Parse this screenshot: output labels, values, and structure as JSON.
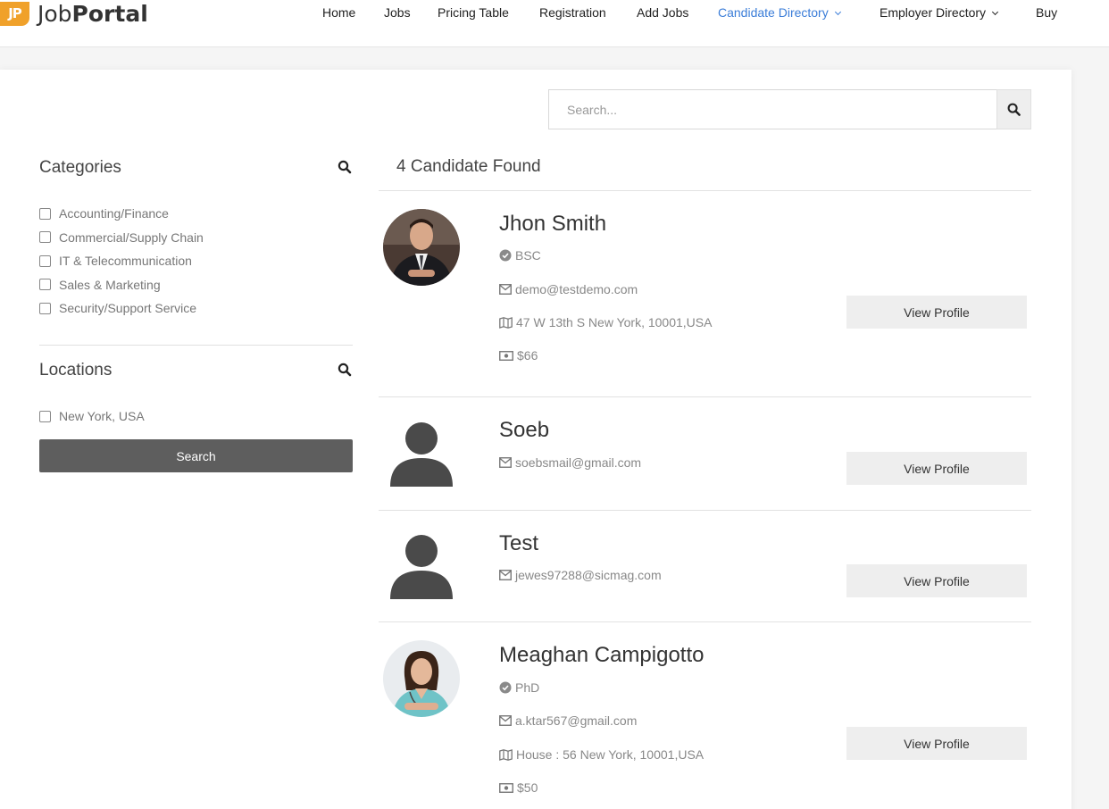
{
  "brand": {
    "logo_mark": "JP",
    "name_part1": "Job",
    "name_part2": "Portal"
  },
  "nav": [
    {
      "label": "Home"
    },
    {
      "label": "Jobs"
    },
    {
      "label": "Pricing Table"
    },
    {
      "label": "Registration"
    },
    {
      "label": "Add Jobs"
    },
    {
      "label": "Candidate Directory",
      "active": true,
      "dropdown": true
    },
    {
      "label": "Employer Directory",
      "dropdown": true
    },
    {
      "label": "Buy"
    }
  ],
  "search": {
    "placeholder": "Search...",
    "icon": "search-icon"
  },
  "sidebar": {
    "categories_title": "Categories",
    "categories": [
      "Accounting/Finance",
      "Commercial/Supply Chain",
      "IT & Telecommunication",
      "Sales & Marketing",
      "Security/Support Service"
    ],
    "locations_title": "Locations",
    "locations": [
      "New York, USA"
    ],
    "search_button": "Search"
  },
  "results": {
    "count_label": "4 Candidate Found",
    "view_profile_label": "View Profile",
    "candidates": [
      {
        "name": "Jhon Smith",
        "degree": "BSC",
        "email": "demo@testdemo.com",
        "address": "47 W 13th S New York, 10001,USA",
        "rate": "$66",
        "avatar": "photo-man"
      },
      {
        "name": "Soeb",
        "email": "soebsmail@gmail.com",
        "avatar": "generic"
      },
      {
        "name": "Test",
        "email": "jewes97288@sicmag.com",
        "avatar": "generic"
      },
      {
        "name": "Meaghan Campigotto",
        "degree": "PhD",
        "email": "a.ktar567@gmail.com",
        "address": "House : 56 New York, 10001,USA",
        "rate": "$50",
        "avatar": "photo-woman"
      }
    ]
  },
  "colors": {
    "accent": "#3b7dd8",
    "logo": "#f0a12a",
    "button_dark": "#5e5e5e",
    "button_light": "#eeeeee"
  }
}
